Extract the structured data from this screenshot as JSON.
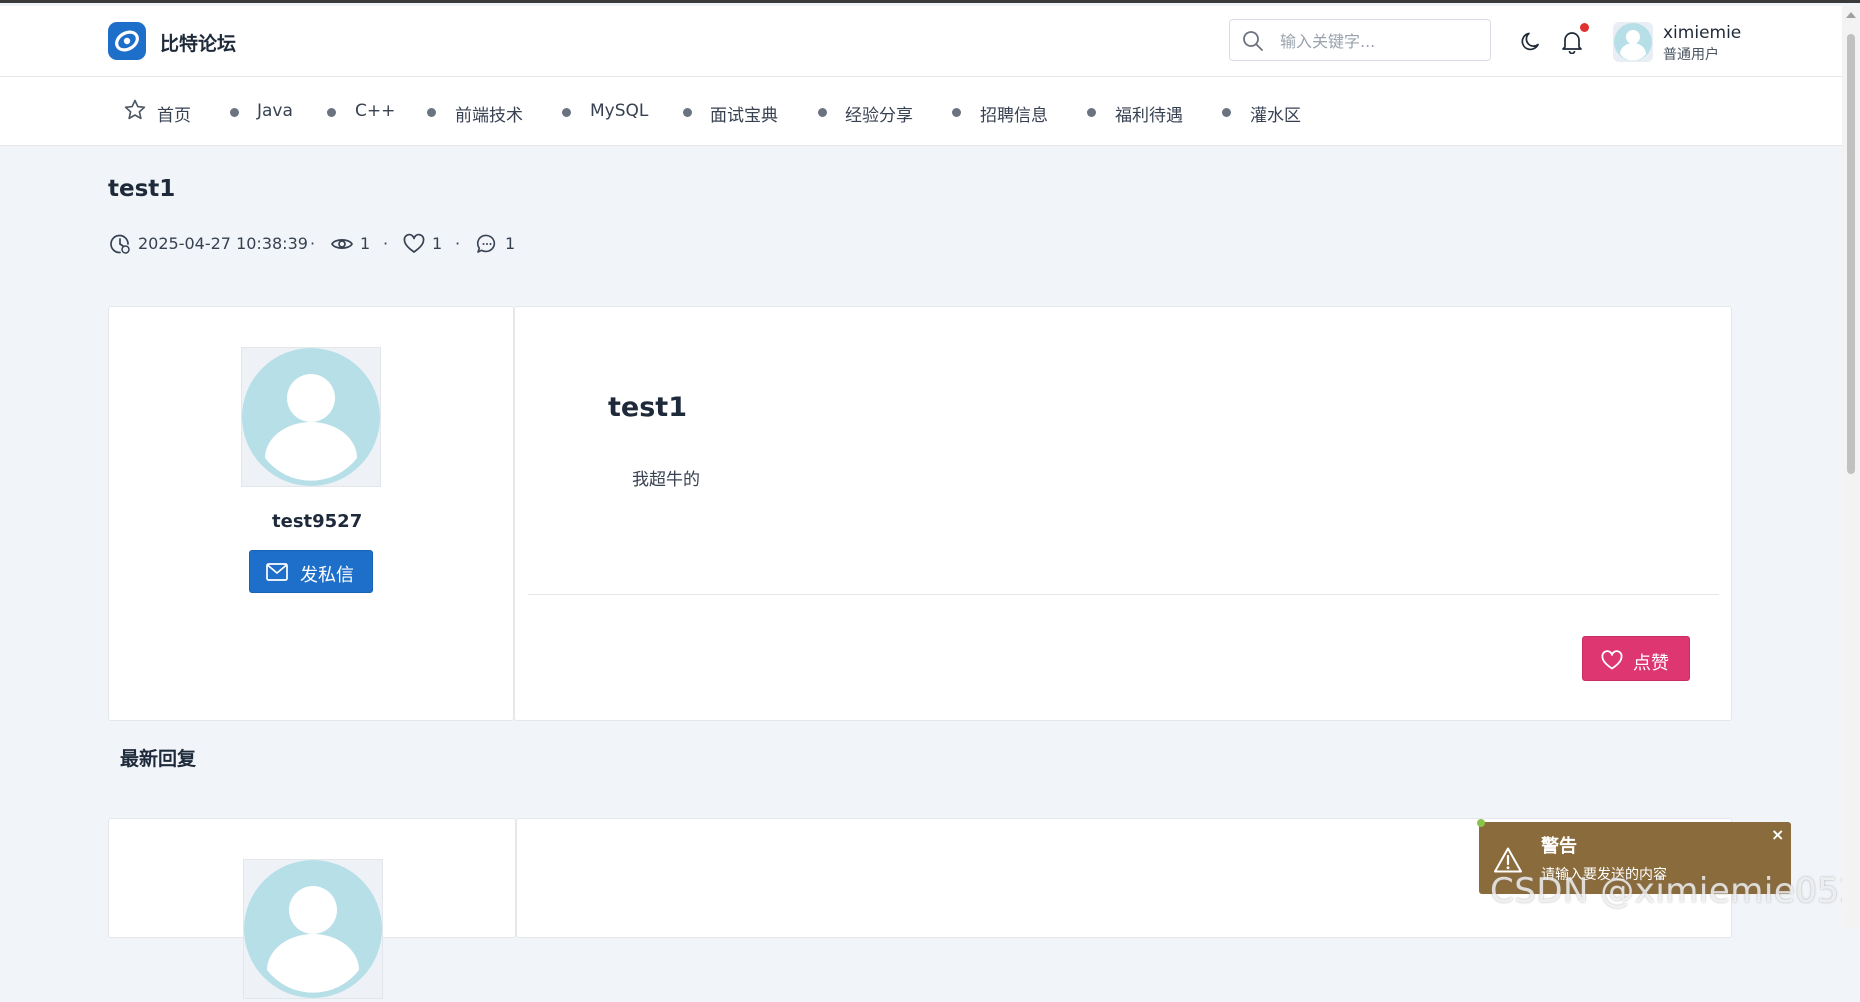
{
  "header": {
    "brand": "比特论坛",
    "search_placeholder": "输入关键字...",
    "user": {
      "name": "ximiemie",
      "role": "普通用户"
    }
  },
  "nav": {
    "home": "首页",
    "items": [
      "Java",
      "C++",
      "前端技术",
      "MySQL",
      "面试宝典",
      "经验分享",
      "招聘信息",
      "福利待遇",
      "灌水区"
    ]
  },
  "post": {
    "title": "test1",
    "timestamp": "2025-04-27 10:38:39",
    "views": "1",
    "likes": "1",
    "comments": "1",
    "separator": "·"
  },
  "author": {
    "name": "test9527",
    "dm_label": "发私信"
  },
  "content": {
    "title": "test1",
    "body": "我超牛的",
    "like_label": "点赞"
  },
  "replies": {
    "section_title": "最新回复"
  },
  "toast": {
    "title": "警告",
    "message": "请输入要发送的内容",
    "close": "×"
  },
  "watermark": "CSDN @ximiemie0525",
  "colors": {
    "primary": "#1e6fc9",
    "like": "#dd3670",
    "toast_bg": "#8a6b3c",
    "avatar": "#b7dfe8"
  }
}
